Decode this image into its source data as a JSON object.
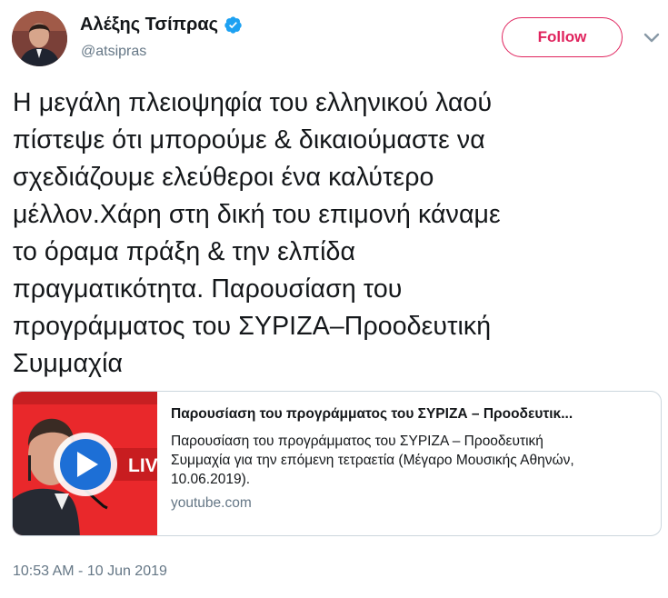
{
  "author": {
    "display_name": "Αλέξης Τσίπρας",
    "handle": "@atsipras",
    "verified": true,
    "avatar_icon": "profile-photo"
  },
  "follow_button": {
    "label": "Follow",
    "color": "#e0245e"
  },
  "menu_icon": "chevron-down-icon",
  "tweet": {
    "lines": [
      "Η μεγάλη πλειοψηφία του ελληνικού λαού",
      "πίστεψε ότι μπορούμε & δικαιούμαστε να",
      "σχεδιάζουμε ελεύθεροι ένα καλύτερο",
      "μέλλον.Χάρη στη δική του επιμονή κάναμε",
      "το όραμα πράξη & την ελπίδα",
      "πραγματικότητα. Παρουσίαση του",
      "προγράμματος του ΣΥΡΙΖΑ–Προοδευτική",
      "Συμμαχία"
    ]
  },
  "link_card": {
    "title": "Παρουσίαση του προγράμματος του ΣΥΡΙΖΑ – Προοδευτικ...",
    "description_lines": [
      "Παρουσίαση του προγράμματος του ΣΥΡΙΖΑ – Προοδευτική",
      "Συμμαχία για την επόμενη τετραετία (Μέγαρο Μουσικής Αθηνών,",
      "10.06.2019)."
    ],
    "domain": "youtube.com",
    "thumb_badge": "LIV",
    "play_icon": "play-icon"
  },
  "timestamp": "10:53 AM - 10 Jun 2019",
  "colors": {
    "text": "#14171a",
    "secondary": "#657786",
    "verified_blue": "#1da1f2",
    "border": "#ccd6dd",
    "thumb_red": "#e9282b"
  }
}
